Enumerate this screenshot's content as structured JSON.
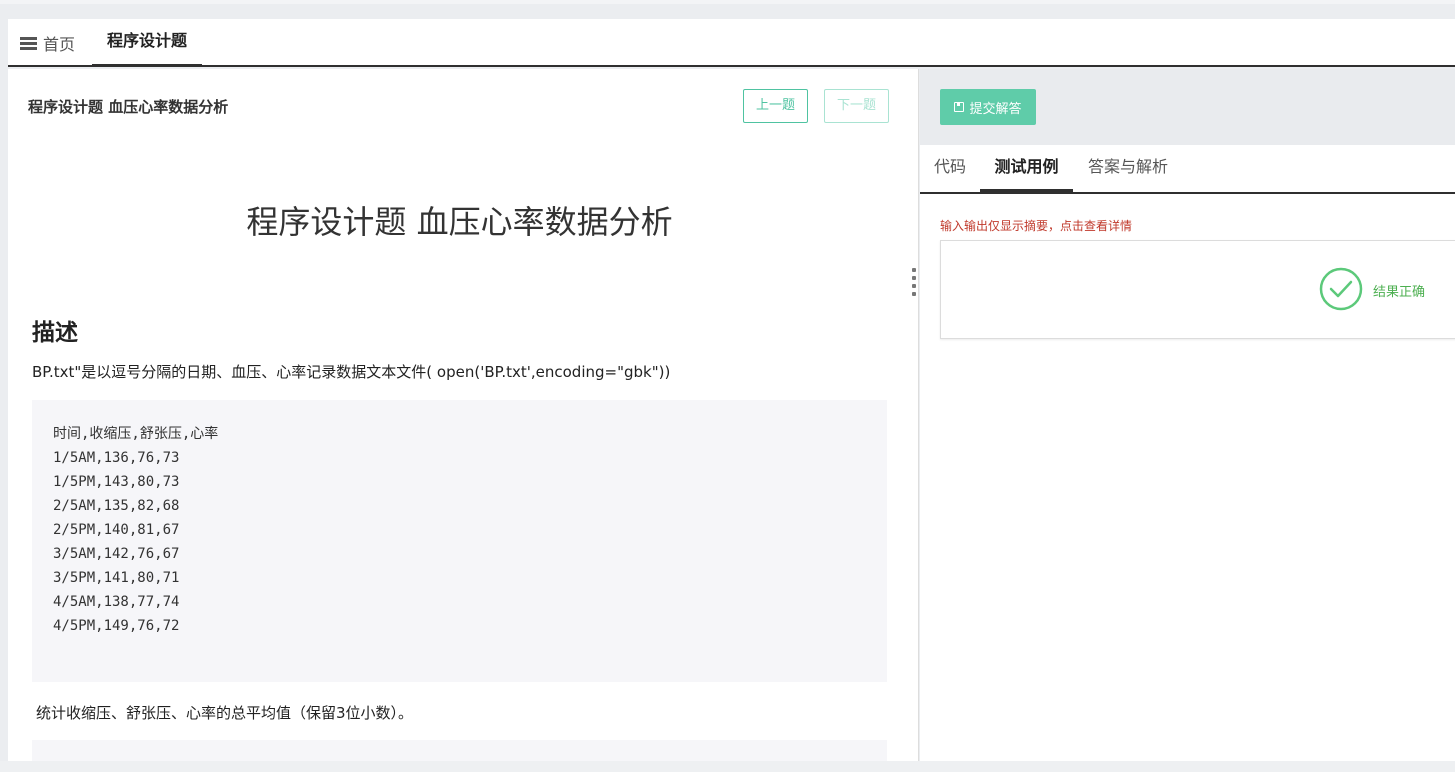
{
  "tabs": {
    "home_label": "首页",
    "problem_label": "程序设计题"
  },
  "problem": {
    "header_title": "程序设计题 血压心率数据分析",
    "prev_label": "上一题",
    "next_label": "下一题",
    "title": "程序设计题 血压心率数据分析",
    "section_heading": "描述",
    "description": "BP.txt\"是以逗号分隔的日期、血压、心率记录数据文本文件( open('BP.txt',encoding=\"gbk\"))",
    "code_lines": [
      "时间,收缩压,舒张压,心率",
      "1/5AM,136,76,73",
      "1/5PM,143,80,73",
      "2/5AM,135,82,68",
      "2/5PM,140,81,67",
      "3/5AM,142,76,67",
      "3/5PM,141,80,71",
      "4/5AM,138,77,74",
      "4/5PM,149,76,72"
    ],
    "task": "统计收缩压、舒张压、心率的总平均值（保留3位小数）。"
  },
  "right": {
    "submit_label": "提交解答",
    "subtabs": [
      "代码",
      "测试用例",
      "答案与解析"
    ],
    "active_subtab": "测试用例",
    "hint": "输入输出仅显示摘要，点击查看详情",
    "result_text": "结果正确"
  },
  "colors": {
    "accent": "#5fcca9",
    "success": "#4caf50",
    "hint": "#c0392b"
  }
}
